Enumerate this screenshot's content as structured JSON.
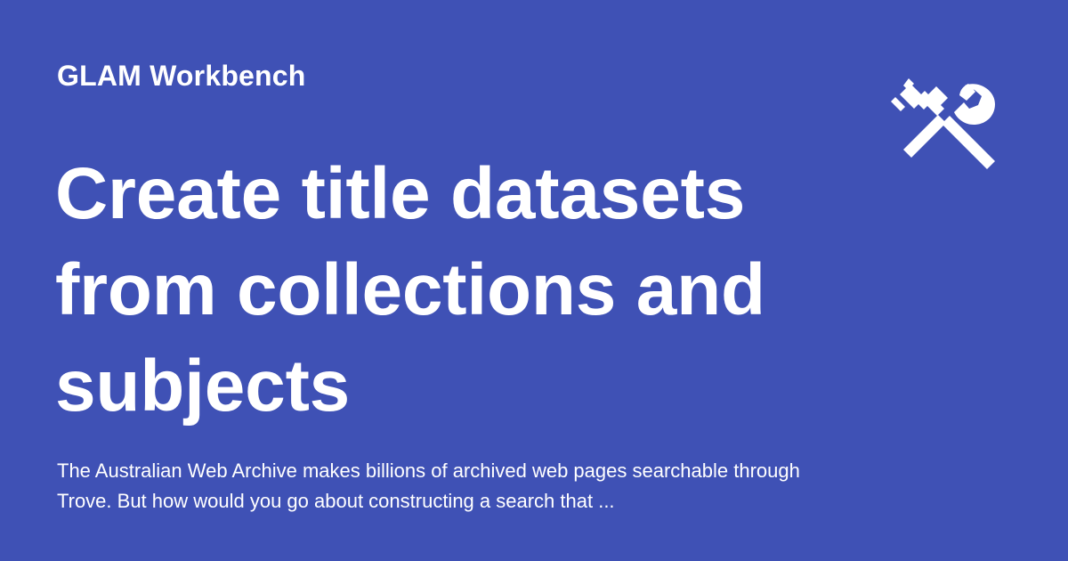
{
  "site": {
    "name": "GLAM Workbench",
    "logo_icon": "hammer-and-wrench-icon"
  },
  "page": {
    "title": "Create title datasets from collections and subjects",
    "description": "The Australian Web Archive makes billions of archived web pages searchable through Trove. But how would you go about constructing a search that ..."
  },
  "colors": {
    "background": "#3f51b5",
    "text": "#ffffff"
  }
}
